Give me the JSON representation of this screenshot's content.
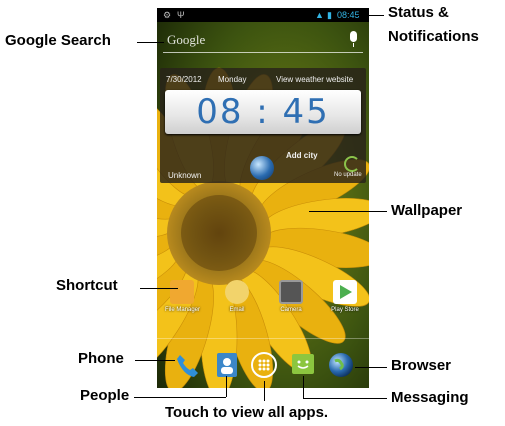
{
  "callouts": {
    "google_search": "Google Search",
    "status_line1": "Status &",
    "status_line2": "Notifications",
    "wallpaper": "Wallpaper",
    "shortcut": "Shortcut",
    "phone": "Phone",
    "browser": "Browser",
    "people": "People",
    "messaging": "Messaging",
    "all_apps": "Touch to view all apps."
  },
  "status_bar": {
    "time": "08:45"
  },
  "search": {
    "logo": "Google",
    "icon": "mic-icon"
  },
  "weather_widget": {
    "date": "7/30/2012",
    "day": "Monday",
    "link": "View weather website",
    "time": "08 : 45",
    "add_city": "Add city",
    "location": "Unknown",
    "update": "No update"
  },
  "apps": [
    {
      "label": "File Manager",
      "icon": "folder-icon",
      "color": "#f0a830"
    },
    {
      "label": "Email",
      "icon": "email-icon",
      "color": "#f2d36b"
    },
    {
      "label": "Camera",
      "icon": "camera-icon",
      "color": "#555555"
    },
    {
      "label": "Play Store",
      "icon": "play-store-icon",
      "color": "#ffffff"
    }
  ],
  "dock": [
    {
      "name": "phone",
      "icon": "phone-icon",
      "color": "#2f8fd8"
    },
    {
      "name": "people",
      "icon": "people-icon",
      "color": "#3b87c9"
    },
    {
      "name": "all-apps",
      "icon": "all-apps-icon",
      "color": "#ffffff"
    },
    {
      "name": "messaging",
      "icon": "messaging-icon",
      "color": "#8cc63f"
    },
    {
      "name": "browser",
      "icon": "browser-icon",
      "color": "#2a6bb0"
    }
  ]
}
